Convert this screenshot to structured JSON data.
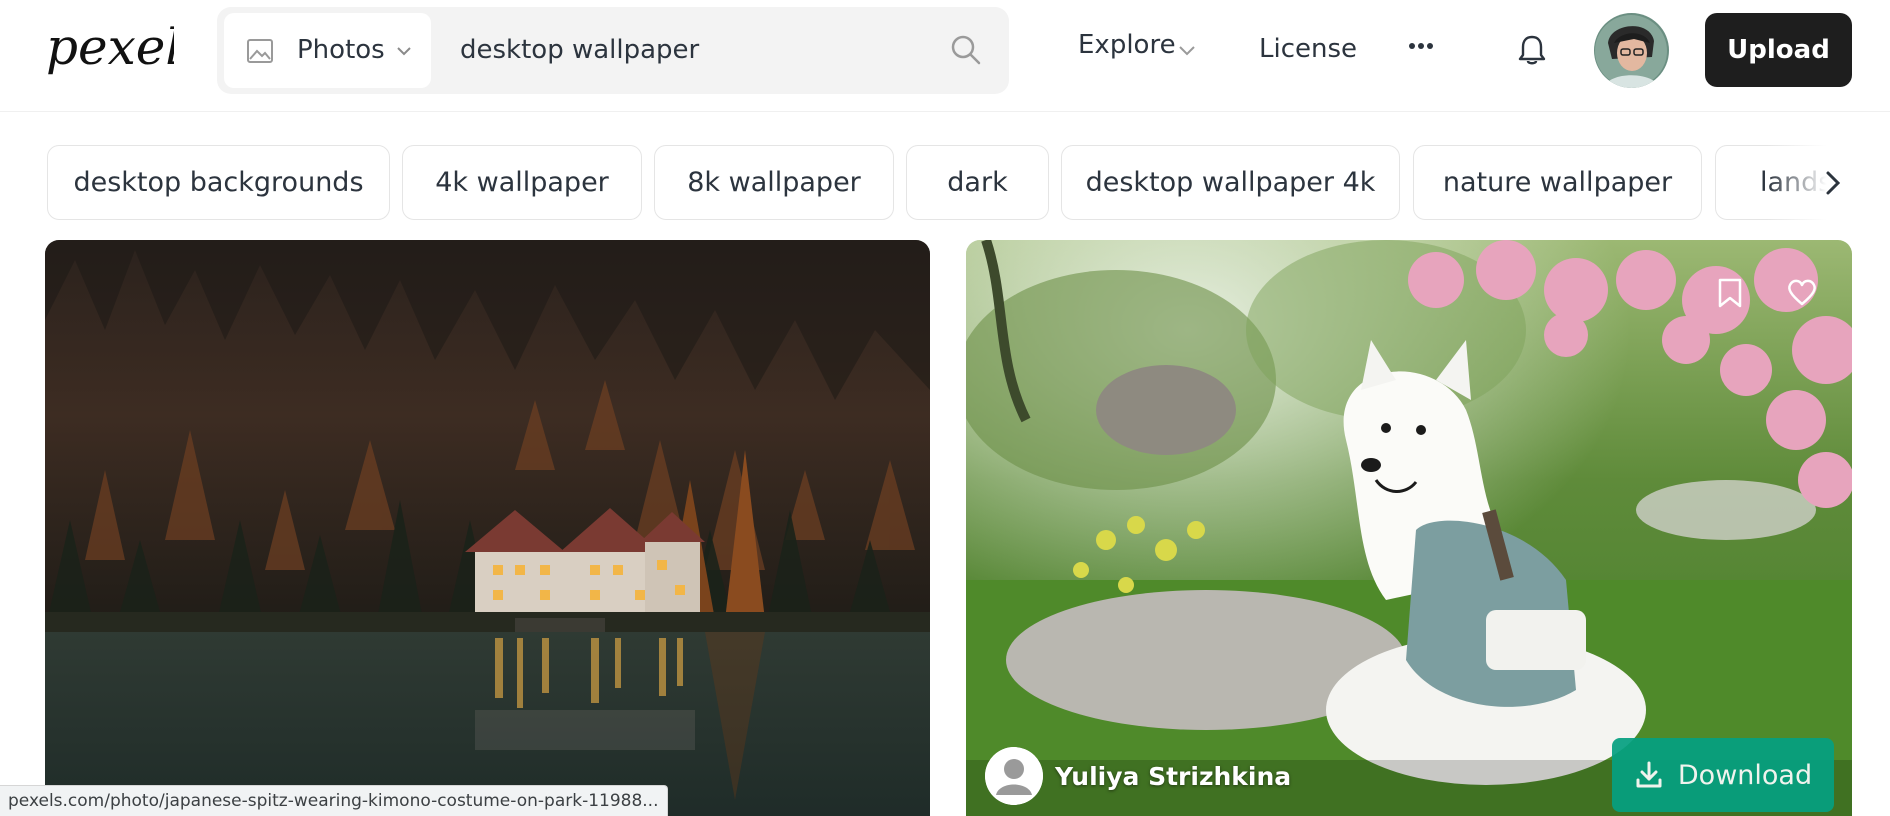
{
  "brand": {
    "logo_text": "pexels"
  },
  "search": {
    "type_label": "Photos",
    "query": "desktop wallpaper"
  },
  "nav": {
    "explore_label": "Explore",
    "license_label": "License",
    "upload_label": "Upload"
  },
  "chips": [
    {
      "label": "desktop backgrounds"
    },
    {
      "label": "4k wallpaper"
    },
    {
      "label": "8k wallpaper"
    },
    {
      "label": "dark"
    },
    {
      "label": "desktop wallpaper 4k"
    },
    {
      "label": "nature wallpaper"
    },
    {
      "label": "landsca"
    }
  ],
  "photos": [
    {
      "subject": "lakeside house in autumn forest at dusk"
    },
    {
      "subject": "japanese spitz wearing kimono under cherry blossoms",
      "author_name": "Yuliya Strizhkina",
      "download_label": "Download"
    }
  ],
  "status_bar": {
    "url": "pexels.com/photo/japanese-spitz-wearing-kimono-costume-on-park-11988..."
  },
  "colors": {
    "accent": "#05a081",
    "upload_bg": "#1e1e1e",
    "search_bg": "#f3f3f3"
  }
}
